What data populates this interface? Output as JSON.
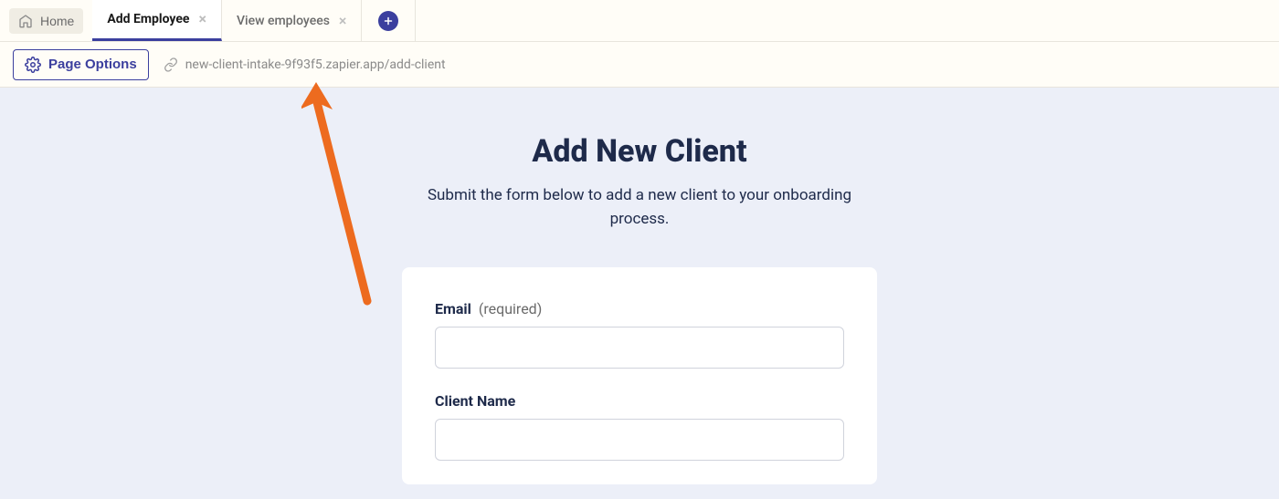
{
  "tab_bar": {
    "home_label": "Home",
    "tabs": [
      {
        "label": "Add Employee"
      },
      {
        "label": "View employees"
      }
    ]
  },
  "sub_bar": {
    "page_options_label": "Page Options",
    "url": "new-client-intake-9f93f5.zapier.app/add-client"
  },
  "main": {
    "heading": "Add New Client",
    "subheading": "Submit the form below to add a new client to your onboarding process.",
    "form": {
      "fields": [
        {
          "label": "Email",
          "required_text": "(required)",
          "value": ""
        },
        {
          "label": "Client Name",
          "value": ""
        }
      ]
    }
  }
}
